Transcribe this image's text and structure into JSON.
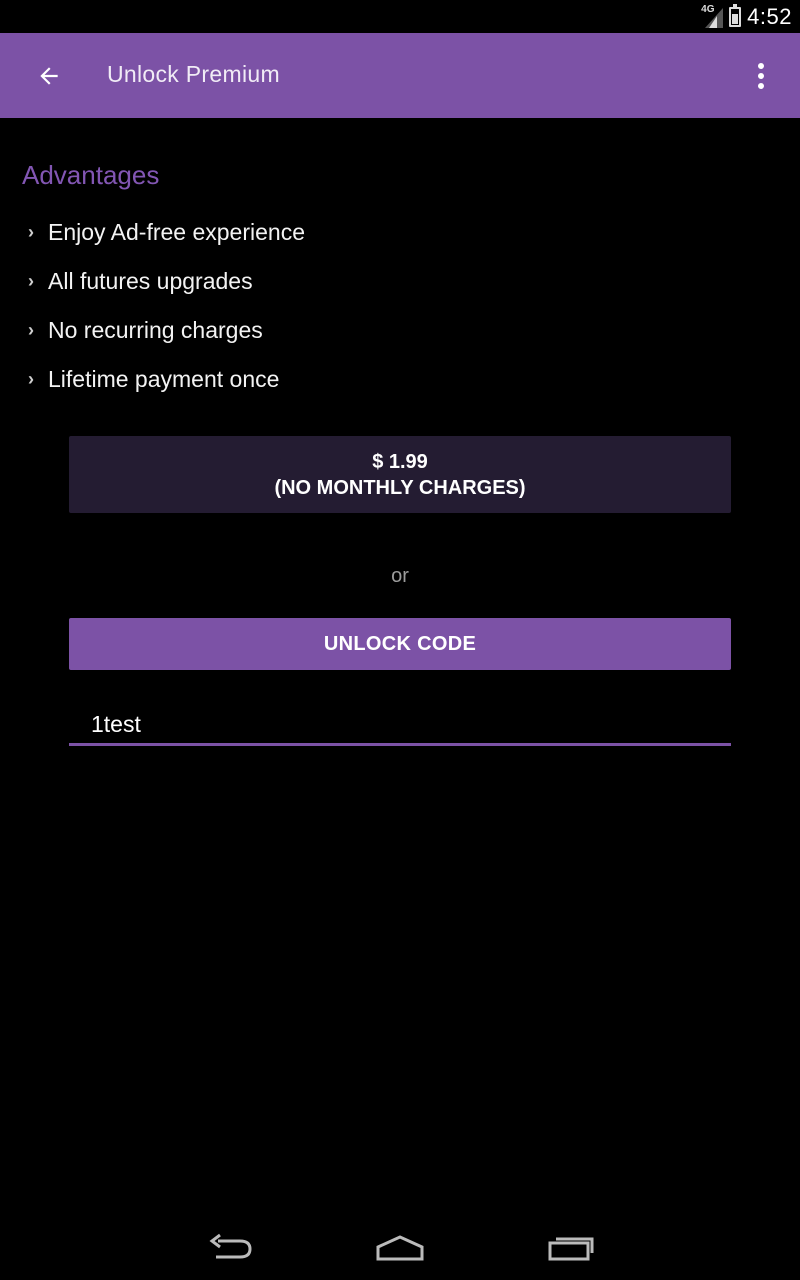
{
  "status_bar": {
    "network_label": "4G",
    "time": "4:52"
  },
  "app_bar": {
    "title": "Unlock Premium",
    "back_icon": "arrow-back-icon",
    "overflow_icon": "more-vert-icon",
    "color": "#7c52a6"
  },
  "advantages": {
    "title": "Advantages",
    "items": [
      {
        "label": "Enjoy Ad-free experience"
      },
      {
        "label": "All futures upgrades"
      },
      {
        "label": "No recurring charges"
      },
      {
        "label": "Lifetime payment once"
      }
    ]
  },
  "purchase": {
    "price_label": "$ 1.99",
    "price_note": "(NO MONTHLY CHARGES)"
  },
  "or_label": "or",
  "unlock": {
    "button_label": "UNLOCK CODE",
    "code_value": "1test"
  },
  "nav": {
    "back_icon": "nav-back-icon",
    "home_icon": "nav-home-icon",
    "recents_icon": "nav-recents-icon"
  },
  "colors": {
    "accent": "#7c52a6",
    "price_button_bg": "#241c32",
    "background": "#000000"
  }
}
